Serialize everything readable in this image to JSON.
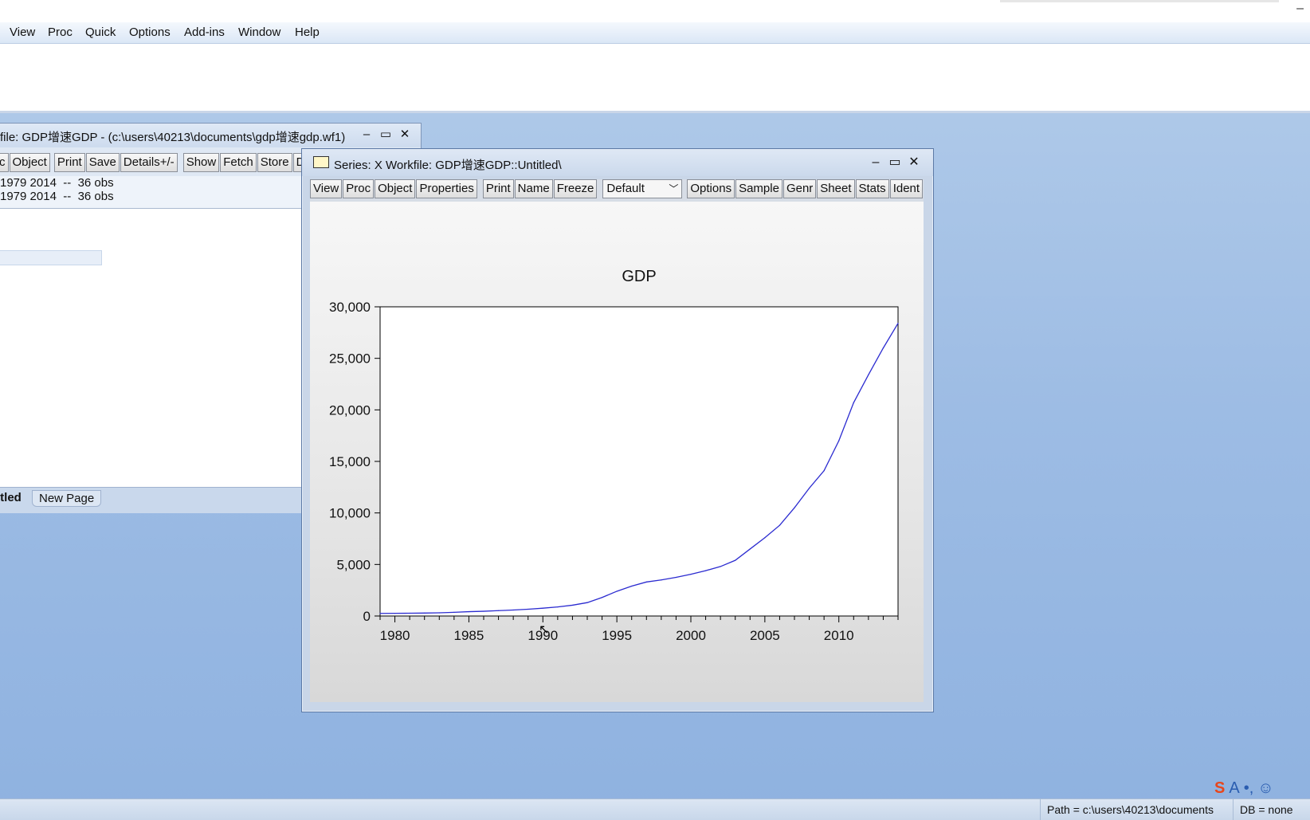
{
  "menubar": {
    "items": [
      "View",
      "Proc",
      "Quick",
      "Options",
      "Add-ins",
      "Window",
      "Help"
    ]
  },
  "workfile_window": {
    "title": "file: GDP增速GDP - (c:\\users\\40213\\documents\\gdp增速gdp.wf1)",
    "toolbar": [
      "c",
      "Object",
      "Print",
      "Save",
      "Details+/-",
      "Show",
      "Fetch",
      "Store",
      "De"
    ],
    "range_line": "1979 2014  --  36 obs",
    "sample_line": "1979 2014  --  36 obs",
    "tabs": [
      "itled",
      "New Page"
    ]
  },
  "series_window": {
    "title": "Series: X   Workfile: GDP增速GDP::Untitled\\",
    "toolbar_left": [
      "View",
      "Proc",
      "Object",
      "Properties"
    ],
    "toolbar_mid": [
      "Print",
      "Name",
      "Freeze"
    ],
    "dropdown_value": "Default",
    "toolbar_right": [
      "Options",
      "Sample",
      "Genr",
      "Sheet",
      "Stats",
      "Ident"
    ]
  },
  "chart_data": {
    "type": "line",
    "title": "GDP",
    "xlabel": "",
    "ylabel": "",
    "x": [
      1979,
      1980,
      1981,
      1982,
      1983,
      1984,
      1985,
      1986,
      1987,
      1988,
      1989,
      1990,
      1991,
      1992,
      1993,
      1994,
      1995,
      1996,
      1997,
      1998,
      1999,
      2000,
      2001,
      2002,
      2003,
      2004,
      2005,
      2006,
      2007,
      2008,
      2009,
      2010,
      2011,
      2012,
      2013,
      2014
    ],
    "series": [
      {
        "values": [
          250,
          260,
          270,
          285,
          310,
          360,
          420,
          460,
          520,
          580,
          660,
          760,
          880,
          1050,
          1300,
          1800,
          2400,
          2900,
          3300,
          3500,
          3750,
          4050,
          4400,
          4800,
          5400,
          6500,
          7600,
          8800,
          10500,
          12400,
          14100,
          17000,
          20700,
          23400,
          26000,
          28400
        ],
        "color": "#2b2bd0"
      }
    ],
    "xlim": [
      1979,
      2014
    ],
    "ylim": [
      0,
      30000
    ],
    "xticks": [
      "1980",
      "1985",
      "1990",
      "1995",
      "2000",
      "2005",
      "2010"
    ],
    "yticks": [
      "0",
      "5,000",
      "10,000",
      "15,000",
      "20,000",
      "25,000",
      "30,000"
    ],
    "grid": false
  },
  "statusbar": {
    "path": "Path = c:\\users\\40213\\documents",
    "db": "DB = none"
  }
}
